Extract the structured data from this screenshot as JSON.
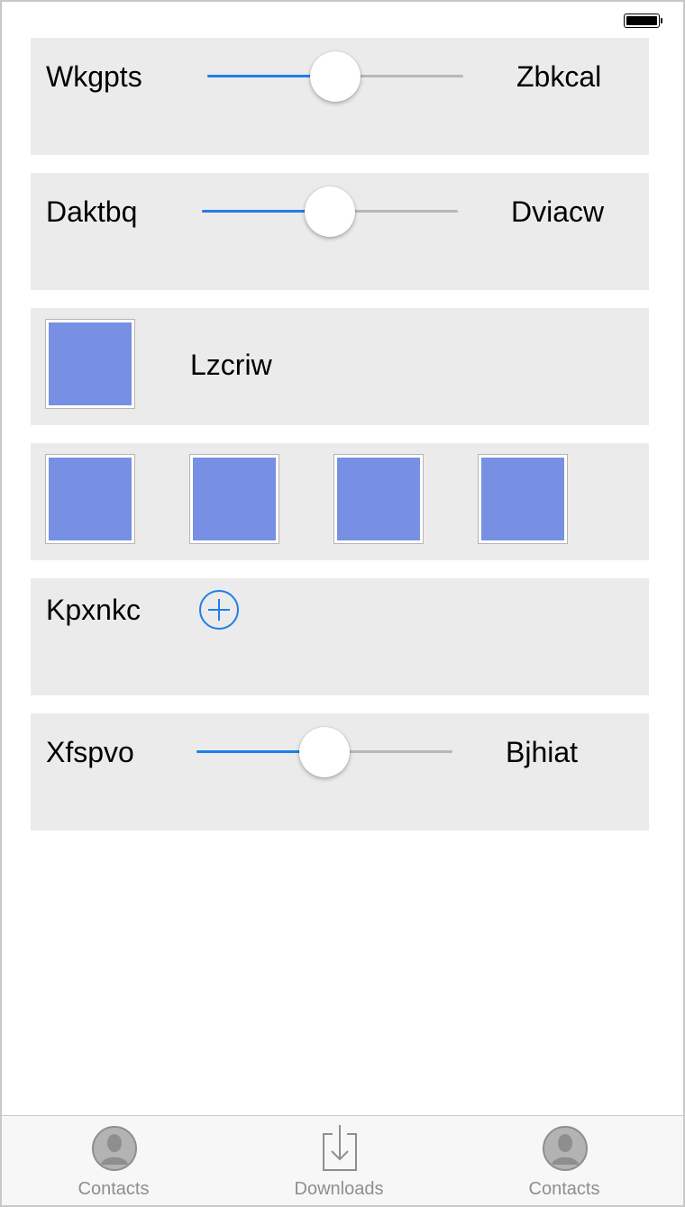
{
  "colors": {
    "accent": "#1f7ee8",
    "row_background": "#ebebeb",
    "thumbnail_fill": "#7790e4",
    "tab_inactive": "#8e8e8e"
  },
  "status_bar": {
    "battery_icon": "battery-full-icon"
  },
  "rows": [
    {
      "type": "slider",
      "left_label": "Wkgpts",
      "right_label": "Zbkcal",
      "value": 0.5
    },
    {
      "type": "slider",
      "left_label": "Daktbq",
      "right_label": "Dviacw",
      "value": 0.5
    },
    {
      "type": "image_label",
      "label": "Lzcriw"
    },
    {
      "type": "image_grid",
      "count": 4
    },
    {
      "type": "add",
      "label": "Kpxnkc",
      "icon": "plus-circle-icon"
    },
    {
      "type": "slider",
      "left_label": "Xfspvo",
      "right_label": "Bjhiat",
      "value": 0.5
    }
  ],
  "tabbar": {
    "tabs": [
      {
        "label": "Contacts",
        "icon": "contact-icon"
      },
      {
        "label": "Downloads",
        "icon": "download-icon"
      },
      {
        "label": "Contacts",
        "icon": "contact-icon"
      }
    ]
  }
}
